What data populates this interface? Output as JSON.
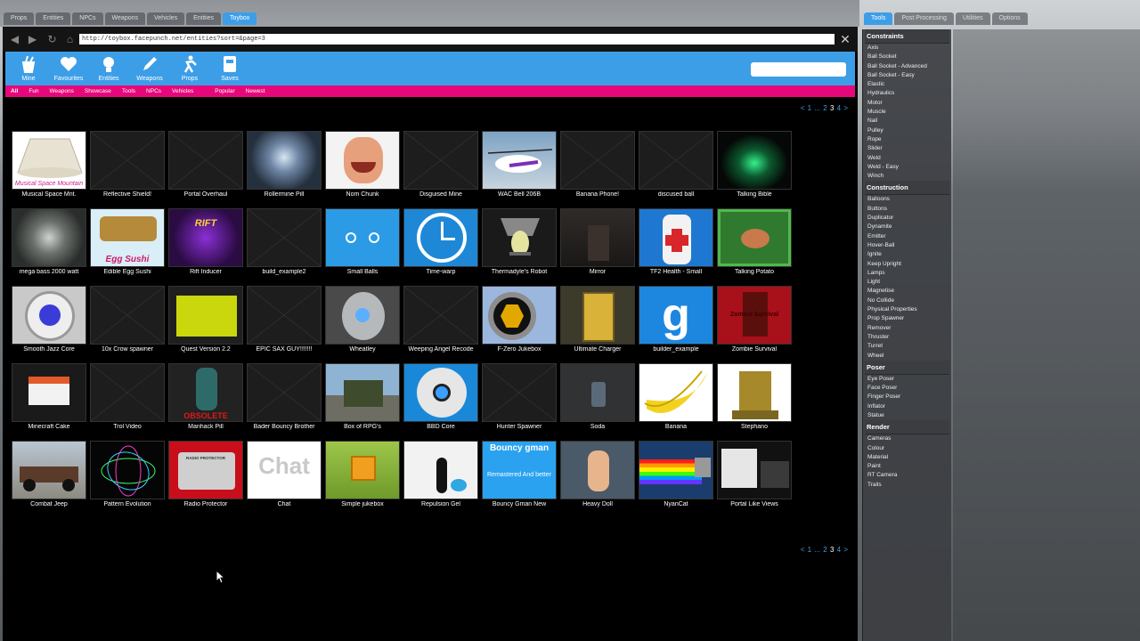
{
  "top_tabs": [
    "Props",
    "Entities",
    "NPCs",
    "Weapons",
    "Vehicles",
    "Entities",
    "Toybox"
  ],
  "right_tabs": [
    "Tools",
    "Post Processing",
    "Utilities",
    "Options"
  ],
  "browser": {
    "url": "http://toybox.facepunch.net/entities?sort=&page=3",
    "toolbar": [
      "Mine",
      "Favourites",
      "Entities",
      "Weapons",
      "Props",
      "Saves"
    ],
    "categories": [
      "All",
      "Fun",
      "Weapons",
      "Showcase",
      "Tools",
      "NPCs",
      "Vehicles",
      "Popular",
      "Newest"
    ],
    "pager": {
      "prev": "<",
      "pages": [
        "1",
        "...",
        "2",
        "3",
        "4"
      ],
      "current": "3",
      "next": ">"
    }
  },
  "colors": {
    "accent": "#3d9ee8",
    "category_bar": "#e6087a"
  },
  "items": [
    "Musical Space Mnt.",
    "Reflective Shield!",
    "Portal Overhaul",
    "Rollermine Pill",
    "Nom Chunk",
    "Disguised Mine",
    "WAC Bell 206B",
    "Banana Phone!",
    "discused ball",
    "Talking Bible",
    "mega bass 2000 watt",
    "Edible Egg Sushi",
    "Rift Inducer",
    "build_example2",
    "Small Balls",
    "Time-warp",
    "Thermadyle's Robot",
    "Mirror",
    "TF2 Health - Small",
    "Talking Potato",
    "Smooth Jazz Core",
    "10x Crow spawner",
    "Quest Version 2.2",
    "EPIC SAX GUY!!!!!!!",
    "Wheatley",
    "Weeping Angel Recode",
    "F-Zero Jukebox",
    "Ultimate Charger",
    "builder_example",
    "Zombie Survival",
    "Minecraft Cake",
    "Trol Video",
    "Manhack Pill",
    "Bader Bouncy Brother",
    "Box of RPG's",
    "BBD Core",
    "Hunter Spawner",
    "Soda",
    "Banana",
    "Stephano",
    "Combat Jeep",
    "Pattern Evolution",
    "Radio Protector",
    "Chat",
    "Simple jukebox",
    "Repulsion Gel",
    "Bouncy Gman New",
    "Heavy Doll",
    "NyanCat",
    "Portal Like Views"
  ],
  "thumb_text": {
    "musical": "Musical Space Mountain",
    "egg": "Egg Sushi",
    "chat": "Chat",
    "gman": "Bouncy gman",
    "gman_sub": "Remastered And better",
    "zombie": "Zombie Survival",
    "manhack": "OBSOLETE",
    "rift": "RIFT",
    "radio": "RADIO PROTECTOR",
    "gmod": "g"
  },
  "tool_panel": [
    {
      "title": "Constraints",
      "items": [
        "Axis",
        "Ball Socket",
        "Ball Socket - Advanced",
        "Ball Socket - Easy",
        "Elastic",
        "Hydraulics",
        "Motor",
        "Muscle",
        "Nail",
        "Pulley",
        "Rope",
        "Slider",
        "Weld",
        "Weld - Easy",
        "Winch"
      ]
    },
    {
      "title": "Construction",
      "items": [
        "Balloons",
        "Buttons",
        "Duplicator",
        "Dynamite",
        "Emitter",
        "Hover-Ball",
        "Ignite",
        "Keep Upright",
        "Lamps",
        "Light",
        "Magnetise",
        "No Collide",
        "Physical Properties",
        "Prop Spawner",
        "Remover",
        "Thruster",
        "Turret",
        "Wheel"
      ]
    },
    {
      "title": "Poser",
      "items": [
        "Eye Poser",
        "Face Poser",
        "Finger Poser",
        "Inflator",
        "Statue"
      ]
    },
    {
      "title": "Render",
      "items": [
        "Cameras",
        "Colour",
        "Material",
        "Paint",
        "RT Camera",
        "Trails"
      ]
    }
  ]
}
